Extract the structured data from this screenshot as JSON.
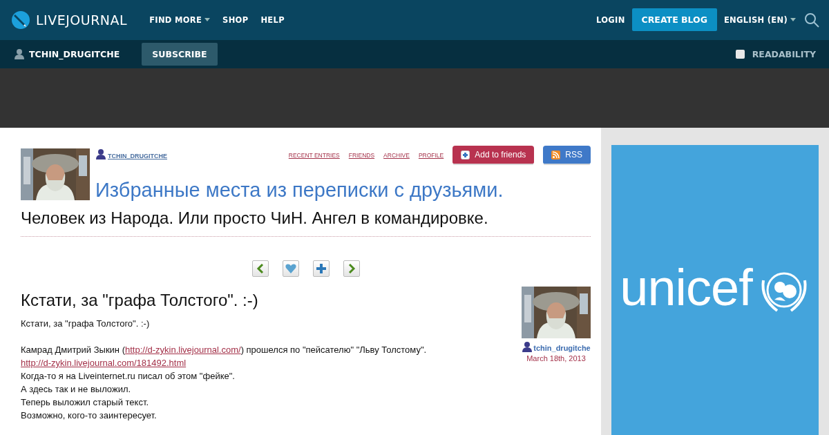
{
  "topbar": {
    "logo": "LIVEJOURNAL",
    "nav": [
      {
        "label": "FIND MORE",
        "dropdown": true
      },
      {
        "label": "SHOP",
        "dropdown": false
      },
      {
        "label": "HELP",
        "dropdown": false
      }
    ],
    "login": "LOGIN",
    "create_blog": "CREATE BLOG",
    "language": "ENGLISH (EN)"
  },
  "subbar": {
    "user": "TCHIN_DRUGITCHE",
    "subscribe": "SUBSCRIBE",
    "readability": {
      "label": "READABILITY",
      "checked": false
    }
  },
  "journal": {
    "user": "TCHIN_DRUGITCHE",
    "links": [
      "RECENT ENTRIES",
      "FRIENDS",
      "ARCHIVE",
      "PROFILE"
    ],
    "add_friends": "Add to friends",
    "rss": "RSS",
    "title": "Избранные места из переписки с друзьями.",
    "subtitle": "Человек из Народа. Или просто ЧиН. Ангел в командировке."
  },
  "entry_nav": [
    {
      "kind": "prev"
    },
    {
      "kind": "heart"
    },
    {
      "kind": "plus"
    },
    {
      "kind": "next"
    }
  ],
  "entry": {
    "title": "Кстати, за \"графа Толстого\". :-)",
    "author": "tchin_drugitche",
    "date": "March 18th, 2013",
    "paragraphs": [
      [
        {
          "kind": "text",
          "text": "Кстати, за \"графа Толстого\". :-)"
        },
        {
          "kind": "break"
        }
      ],
      [
        {
          "kind": "text",
          "text": "Камрад Дмитрий Зыкин ("
        },
        {
          "kind": "link",
          "text": "http://d-zykin.livejournal.com/"
        },
        {
          "kind": "text",
          "text": ") прошелся по \"пейсателю\" \"Льву Толстому\"."
        }
      ],
      [
        {
          "kind": "link",
          "text": "http://d-zykin.livejournal.com/181492.html"
        }
      ],
      [
        {
          "kind": "text",
          "text": "Когда-то я на Liveinternet.ru писал об этом \"фейке\"."
        }
      ],
      [
        {
          "kind": "text",
          "text": "А здесь так и не выложил."
        }
      ],
      [
        {
          "kind": "text",
          "text": "Теперь выложил старый текст."
        }
      ],
      [
        {
          "kind": "text",
          "text": "Возможно, кого-то заинтересует."
        }
      ]
    ]
  },
  "ad": {
    "brand": "unicef"
  }
}
